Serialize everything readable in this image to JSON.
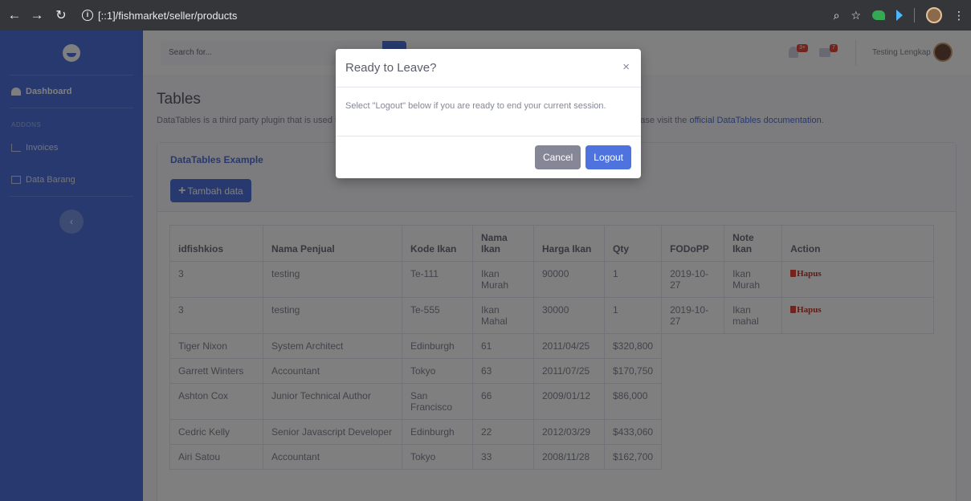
{
  "browser": {
    "url": "[::1]/fishmarket/seller/products"
  },
  "sidebar": {
    "dashboard": "Dashboard",
    "addons_heading": "ADDONS",
    "invoices": "Invoices",
    "data_barang": "Data Barang",
    "toggle_glyph": "‹"
  },
  "topbar": {
    "search_placeholder": "Search for...",
    "alerts_count": "3+",
    "messages_count": "7",
    "user_name": "Testing Lengkap"
  },
  "page": {
    "title": "Tables",
    "desc_prefix": "DataTables is a third party plugin that is used to generate the demo table below. For more information about DataTables, please visit the",
    "desc_link": "official DataTables documentation",
    "desc_suffix": "."
  },
  "card": {
    "title": "DataTables Example",
    "add_label": "Tambah data"
  },
  "table": {
    "headers": [
      "idfishkios",
      "Nama Penjual",
      "Kode Ikan",
      "Nama Ikan",
      "Harga Ikan",
      "Qty",
      "FODoPP",
      "Note Ikan",
      "Action"
    ],
    "rows": [
      [
        "3",
        "testing",
        "Te-111",
        "Ikan Murah",
        "90000",
        "1",
        "2019-10-27",
        "Ikan Murah",
        "Hapus"
      ],
      [
        "3",
        "testing",
        "Te-555",
        "Ikan Mahal",
        "30000",
        "1",
        "2019-10-27",
        "Ikan mahal",
        "Hapus"
      ],
      [
        "Tiger Nixon",
        "System Architect",
        "Edinburgh",
        "61",
        "2011/04/25",
        "$320,800"
      ],
      [
        "Garrett Winters",
        "Accountant",
        "Tokyo",
        "63",
        "2011/07/25",
        "$170,750"
      ],
      [
        "Ashton Cox",
        "Junior Technical Author",
        "San Francisco",
        "66",
        "2009/01/12",
        "$86,000"
      ],
      [
        "Cedric Kelly",
        "Senior Javascript Developer",
        "Edinburgh",
        "22",
        "2012/03/29",
        "$433,060"
      ],
      [
        "Airi Satou",
        "Accountant",
        "Tokyo",
        "33",
        "2008/11/28",
        "$162,700"
      ]
    ]
  },
  "modal": {
    "title": "Ready to Leave?",
    "close": "×",
    "body": "Select \"Logout\" below if you are ready to end your current session.",
    "cancel": "Cancel",
    "logout": "Logout"
  }
}
